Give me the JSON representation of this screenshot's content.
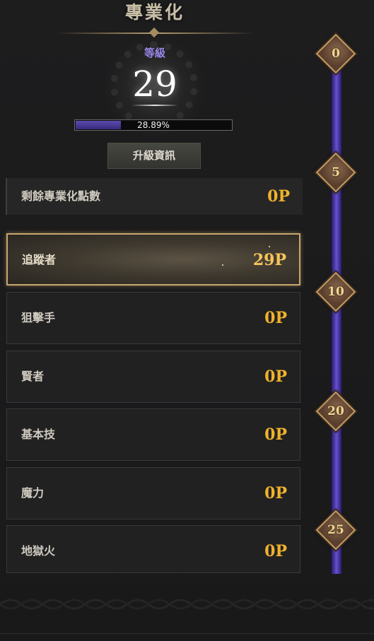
{
  "header": {
    "title": "專業化",
    "level_label": "等級",
    "level_value": "29",
    "progress_text": "28.89%",
    "progress_fraction": 0.2889,
    "info_button": "升級資訊"
  },
  "remaining": {
    "label": "剩餘專業化點數",
    "points": "0P"
  },
  "specs": [
    {
      "name": "追蹤者",
      "points": "29P",
      "selected": true
    },
    {
      "name": "狙擊手",
      "points": "0P"
    },
    {
      "name": "賢者",
      "points": "0P"
    },
    {
      "name": "基本技",
      "points": "0P"
    },
    {
      "name": "魔力",
      "points": "0P"
    },
    {
      "name": "地獄火",
      "points": "0P"
    }
  ],
  "milestones": [
    "0",
    "5",
    "10",
    "20",
    "25"
  ],
  "colors": {
    "accent_purple": "#9b86e8",
    "points_gold": "#f0b22c",
    "frame_gold": "#c7a86d",
    "bar_purple": "#6650d0"
  }
}
